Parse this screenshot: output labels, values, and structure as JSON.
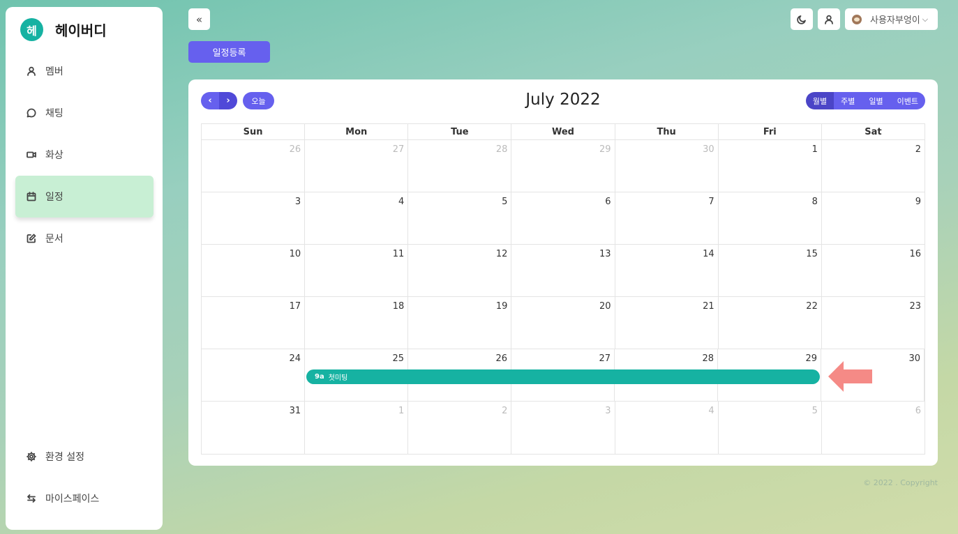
{
  "sidebar": {
    "logo_char": "헤",
    "brand_name": "헤이버디",
    "items": [
      {
        "label": "멤버",
        "icon": "user-icon"
      },
      {
        "label": "채팅",
        "icon": "chat-bubble-icon"
      },
      {
        "label": "화상",
        "icon": "video-icon"
      },
      {
        "label": "일정",
        "icon": "calendar-icon",
        "active": true
      },
      {
        "label": "문서",
        "icon": "edit-document-icon"
      }
    ],
    "bottom_items": [
      {
        "label": "환경 설정",
        "icon": "gear-icon"
      },
      {
        "label": "마이스페이스",
        "icon": "swap-arrows-icon"
      }
    ]
  },
  "header": {
    "collapse_icon": "«",
    "user_name": "사용자부엉이",
    "add_schedule_label": "일정등록"
  },
  "calendar": {
    "title": "July 2022",
    "prev_icon": "‹",
    "next_icon": "›",
    "today_label": "오늘",
    "views": [
      {
        "label": "월별",
        "active": true
      },
      {
        "label": "주별"
      },
      {
        "label": "일별"
      },
      {
        "label": "이벤트"
      }
    ],
    "weekdays": [
      "Sun",
      "Mon",
      "Tue",
      "Wed",
      "Thu",
      "Fri",
      "Sat"
    ],
    "weeks": [
      [
        {
          "d": "26",
          "o": true
        },
        {
          "d": "27",
          "o": true
        },
        {
          "d": "28",
          "o": true
        },
        {
          "d": "29",
          "o": true
        },
        {
          "d": "30",
          "o": true
        },
        {
          "d": "1"
        },
        {
          "d": "2"
        }
      ],
      [
        {
          "d": "3"
        },
        {
          "d": "4"
        },
        {
          "d": "5"
        },
        {
          "d": "6"
        },
        {
          "d": "7"
        },
        {
          "d": "8"
        },
        {
          "d": "9"
        }
      ],
      [
        {
          "d": "10"
        },
        {
          "d": "11"
        },
        {
          "d": "12"
        },
        {
          "d": "13"
        },
        {
          "d": "14"
        },
        {
          "d": "15"
        },
        {
          "d": "16"
        }
      ],
      [
        {
          "d": "17"
        },
        {
          "d": "18"
        },
        {
          "d": "19"
        },
        {
          "d": "20"
        },
        {
          "d": "21"
        },
        {
          "d": "22"
        },
        {
          "d": "23"
        }
      ],
      [
        {
          "d": "24"
        },
        {
          "d": "25"
        },
        {
          "d": "26"
        },
        {
          "d": "27"
        },
        {
          "d": "28"
        },
        {
          "d": "29"
        },
        {
          "d": "30"
        }
      ],
      [
        {
          "d": "31"
        },
        {
          "d": "1",
          "o": true
        },
        {
          "d": "2",
          "o": true
        },
        {
          "d": "3",
          "o": true
        },
        {
          "d": "4",
          "o": true
        },
        {
          "d": "5",
          "o": true
        },
        {
          "d": "6",
          "o": true
        }
      ]
    ],
    "event": {
      "time": "9a",
      "title": "첫미팅",
      "color": "#16b2a2"
    }
  },
  "footer": {
    "copyright": "© 2022 . Copyright"
  },
  "colors": {
    "accent": "#6660ee",
    "brand": "#16b2a2",
    "active_nav": "#c8efd4",
    "pointer": "#f58a86"
  }
}
